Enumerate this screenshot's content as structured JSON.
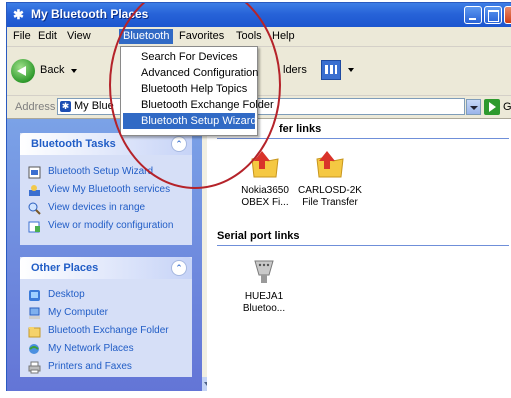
{
  "window": {
    "title": "My Bluetooth Places"
  },
  "menubar": {
    "items": [
      "File",
      "Edit",
      "View",
      "Bluetooth",
      "Favorites",
      "Tools",
      "Help"
    ],
    "active": "Bluetooth"
  },
  "toolbar": {
    "back_label": "Back",
    "folders_label": "lders"
  },
  "address": {
    "label": "Address",
    "value": "My Blue",
    "go_label": "Go"
  },
  "bluetooth_menu": {
    "items": [
      "Search For Devices",
      "Advanced Configuration",
      "Bluetooth Help Topics",
      "Bluetooth Exchange Folder",
      "Bluetooth Setup Wizard"
    ],
    "highlighted": "Bluetooth Setup Wizard"
  },
  "tasks": {
    "title": "Bluetooth Tasks",
    "items": [
      "Bluetooth Setup Wizard",
      "View My Bluetooth services",
      "View devices in range",
      "View or modify configuration"
    ]
  },
  "other_places": {
    "title": "Other Places",
    "items": [
      "Desktop",
      "My Computer",
      "Bluetooth Exchange Folder",
      "My Network Places",
      "Printers and Faxes"
    ]
  },
  "content": {
    "transfer_group": "fer links",
    "transfer_items": [
      {
        "line1": "Nokia3650",
        "line2": "OBEX Fi..."
      },
      {
        "line1": "CARLOSD-2K",
        "line2": "File Transfer"
      }
    ],
    "serial_group": "Serial port links",
    "serial_items": [
      {
        "line1": "HUEJA1",
        "line2": "Bluetoo..."
      }
    ]
  },
  "colors": {
    "annotation_circle": "#b5232a",
    "menu_highlight": "#316ac5",
    "link_text": "#215dc6"
  }
}
